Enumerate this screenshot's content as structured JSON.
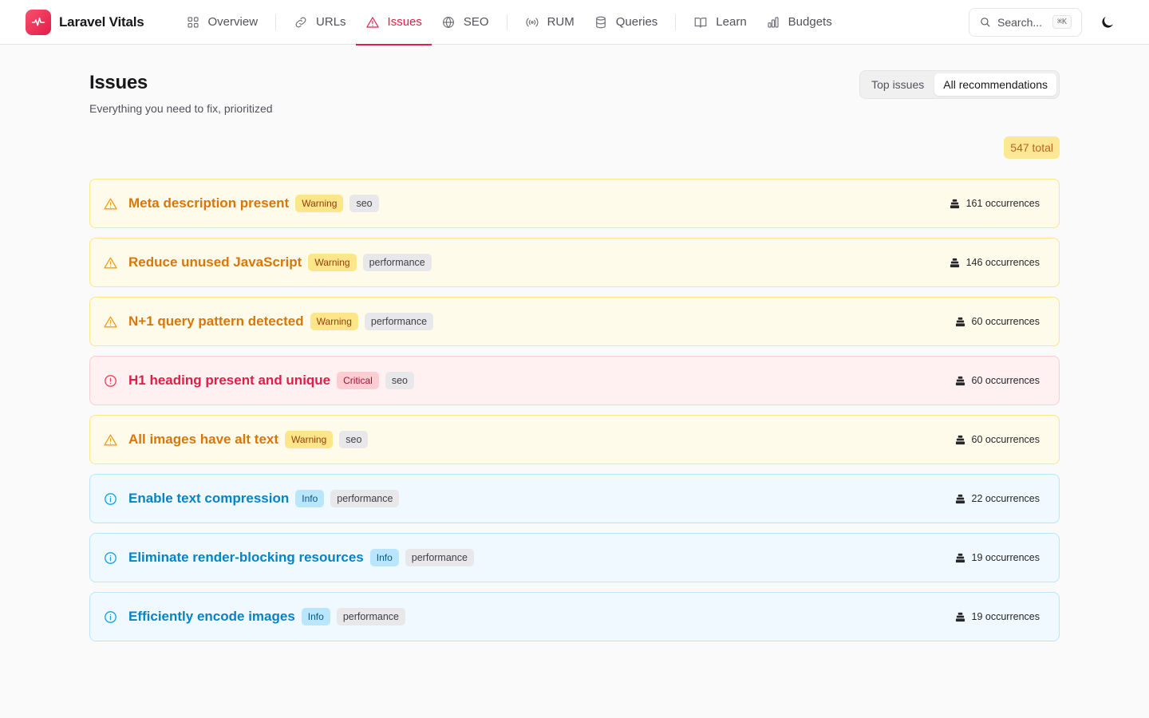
{
  "app": {
    "name": "Laravel Vitals"
  },
  "nav": {
    "items": [
      {
        "label": "Overview",
        "icon": "grid-icon",
        "active": false
      },
      {
        "label": "URLs",
        "icon": "link-icon",
        "active": false
      },
      {
        "label": "Issues",
        "icon": "warning-triangle-icon",
        "active": true
      },
      {
        "label": "SEO",
        "icon": "globe-icon",
        "active": false
      },
      {
        "label": "RUM",
        "icon": "radio-waves-icon",
        "active": false
      },
      {
        "label": "Queries",
        "icon": "database-icon",
        "active": false
      },
      {
        "label": "Learn",
        "icon": "book-icon",
        "active": false
      },
      {
        "label": "Budgets",
        "icon": "bar-chart-icon",
        "active": false
      }
    ],
    "search_label": "Search...",
    "search_shortcut": "⌘K"
  },
  "page": {
    "title": "Issues",
    "subtitle": "Everything you need to fix, prioritized",
    "tabs": [
      {
        "label": "Top issues",
        "selected": false
      },
      {
        "label": "All recommendations",
        "selected": true
      }
    ],
    "total": "547 total"
  },
  "issues": [
    {
      "title": "Meta description present",
      "severity": "Warning",
      "category": "seo",
      "occurrences": "161 occurrences"
    },
    {
      "title": "Reduce unused JavaScript",
      "severity": "Warning",
      "category": "performance",
      "occurrences": "146 occurrences"
    },
    {
      "title": "N+1 query pattern detected",
      "severity": "Warning",
      "category": "performance",
      "occurrences": "60 occurrences"
    },
    {
      "title": "H1 heading present and unique",
      "severity": "Critical",
      "category": "seo",
      "occurrences": "60 occurrences"
    },
    {
      "title": "All images have alt text",
      "severity": "Warning",
      "category": "seo",
      "occurrences": "60 occurrences"
    },
    {
      "title": "Enable text compression",
      "severity": "Info",
      "category": "performance",
      "occurrences": "22 occurrences"
    },
    {
      "title": "Eliminate render-blocking resources",
      "severity": "Info",
      "category": "performance",
      "occurrences": "19 occurrences"
    },
    {
      "title": "Efficiently encode images",
      "severity": "Info",
      "category": "performance",
      "occurrences": "19 occurrences"
    }
  ],
  "colors": {
    "accent": "#e11d48",
    "warning": "#d97706",
    "critical": "#e11d48",
    "info": "#0284c7"
  }
}
